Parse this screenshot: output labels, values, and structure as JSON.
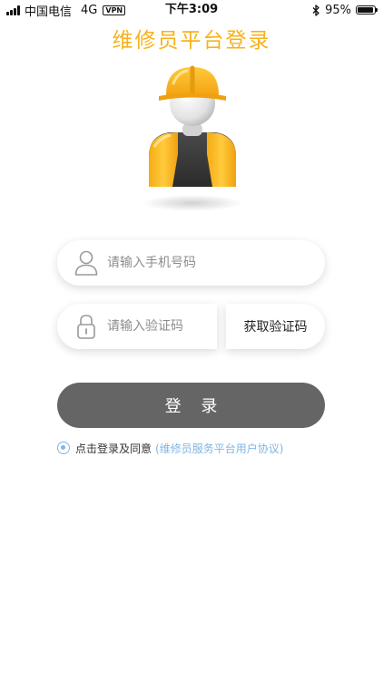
{
  "status_bar": {
    "carrier": "中国电信",
    "network": "4G",
    "vpn": "VPN",
    "time": "下午3:09",
    "battery_percent": "95%",
    "battery_level": 0.95
  },
  "title": "维修员平台登录",
  "mascot": {
    "icon": "worker-avatar-icon"
  },
  "phone": {
    "placeholder": "请输入手机号码",
    "value": "",
    "icon": "user-icon"
  },
  "code": {
    "placeholder": "请输入验证码",
    "value": "",
    "icon": "lock-icon",
    "button_label": "获取验证码"
  },
  "login_label": "登 录",
  "agreement": {
    "text": "点击登录及同意",
    "link": "(维修员服务平台用户协议)"
  },
  "colors": {
    "title": "#f7b21b",
    "login_button": "#656565",
    "link": "#7fb6e4"
  }
}
